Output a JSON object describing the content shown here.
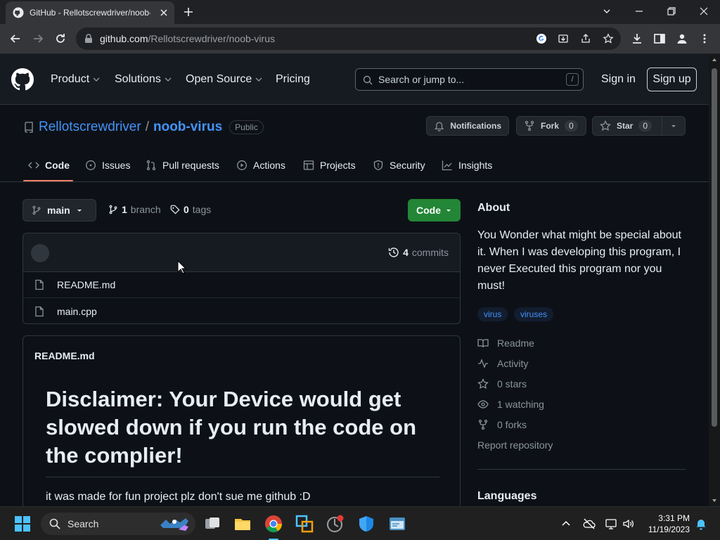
{
  "browser": {
    "tab_title": "GitHub - Rellotscrewdriver/noob-virus",
    "url_host": "github.com",
    "url_path": "/Rellotscrewdriver/noob-virus"
  },
  "header": {
    "nav": [
      {
        "label": "Product",
        "has_caret": true
      },
      {
        "label": "Solutions",
        "has_caret": true
      },
      {
        "label": "Open Source",
        "has_caret": true
      },
      {
        "label": "Pricing",
        "has_caret": false
      }
    ],
    "search_placeholder": "Search or jump to...",
    "search_key": "/",
    "sign_in": "Sign in",
    "sign_up": "Sign up"
  },
  "repo": {
    "owner": "Rellotscrewdriver",
    "separator": "/",
    "name": "noob-virus",
    "visibility": "Public",
    "notifications_label": "Notifications",
    "fork_label": "Fork",
    "fork_count": "0",
    "star_label": "Star",
    "star_count": "0"
  },
  "tabs": [
    "Code",
    "Issues",
    "Pull requests",
    "Actions",
    "Projects",
    "Security",
    "Insights"
  ],
  "main": {
    "branch": "main",
    "branch_count": "1",
    "branch_label": "branch",
    "tag_count": "0",
    "tag_label": "tags",
    "code_button": "Code",
    "commit_count": "4",
    "commit_label": "commits",
    "files": [
      "README.md",
      "main.cpp"
    ]
  },
  "readme": {
    "label": "README.md",
    "heading": "Disclaimer: Your Device would get slowed down if you run the code on the complier!",
    "paragraph": "it was made for fun project plz don't sue me github :D"
  },
  "sidebar": {
    "about_title": "About",
    "description": "You Wonder what might be special about it. When I was developing this program, I never Executed this program nor you must!",
    "topics": [
      "virus",
      "viruses"
    ],
    "readme": "Readme",
    "activity": "Activity",
    "stars": "0 stars",
    "watching": "1 watching",
    "forks": "0 forks",
    "report": "Report repository",
    "languages_title": "Languages"
  },
  "taskbar": {
    "search_label": "Search",
    "time": "3:31 PM",
    "date": "11/19/2023"
  },
  "colors": {
    "page_bg": "#0d1117",
    "header_bg": "#161b22",
    "link": "#4493f8",
    "code_button": "#238636",
    "tab_underline": "#f78166"
  }
}
